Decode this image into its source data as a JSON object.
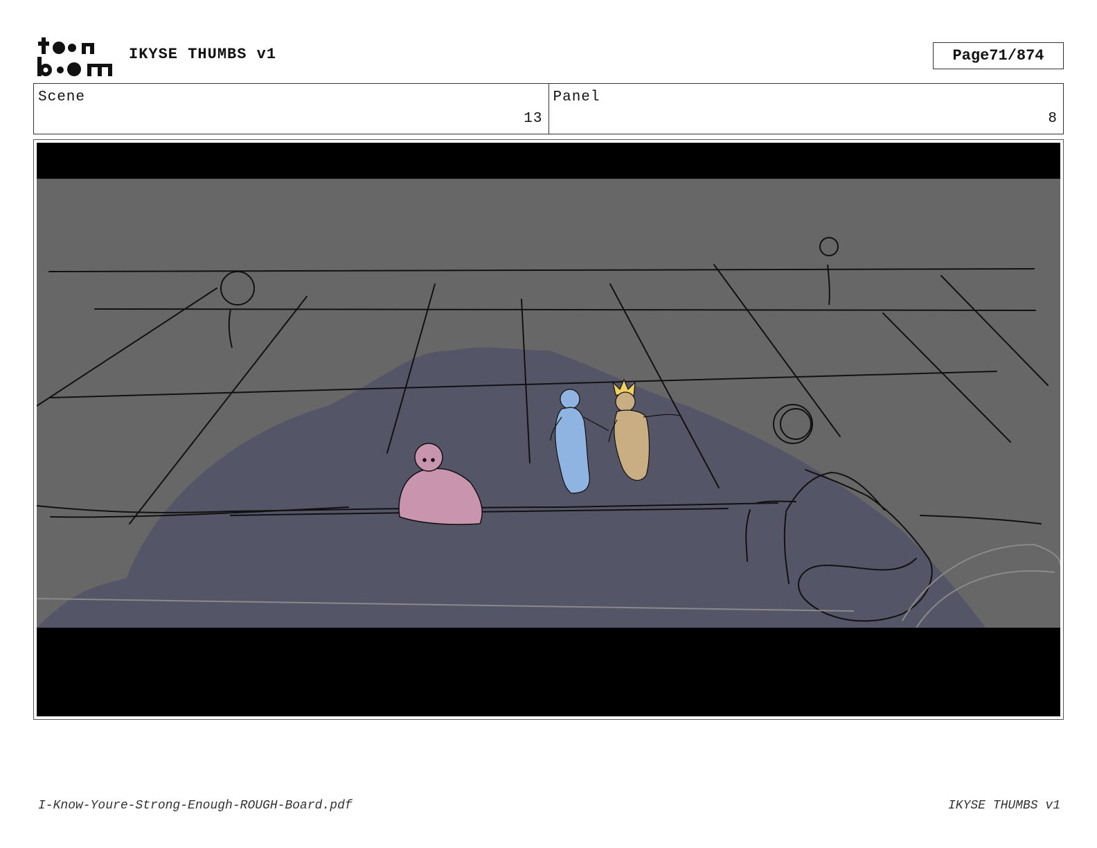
{
  "header": {
    "logo_text": "toon boom",
    "project_title": "IKYSE THUMBS v1",
    "page_label": "Page",
    "page_number": "71/874"
  },
  "info": {
    "scene_label": "Scene",
    "scene_value": "13",
    "panel_label": "Panel",
    "panel_value": "8"
  },
  "colors": {
    "letterbox": "#000000",
    "background": "#676767",
    "shadow": "#555568",
    "pink_character": "#c994ad",
    "blue_character": "#8fb4e1",
    "tan_character": "#c8ae82",
    "crown_highlight": "#f0d060",
    "sketch_line": "#111111"
  },
  "footer": {
    "filename": "I-Know-Youre-Strong-Enough-ROUGH-Board.pdf",
    "project_title": "IKYSE THUMBS v1"
  }
}
